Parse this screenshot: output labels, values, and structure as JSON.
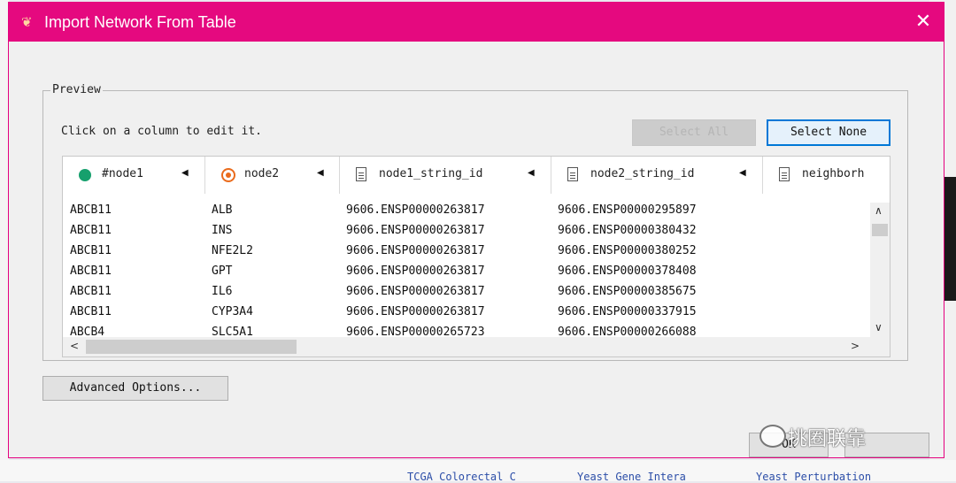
{
  "window": {
    "title": "Import Network From Table",
    "close_glyph": "✕",
    "app_icon": "cytoscape-icon"
  },
  "preview": {
    "legend": "Preview",
    "hint": "Click on a column to edit it.",
    "select_all_label": "Select All",
    "select_none_label": "Select None"
  },
  "table": {
    "columns": [
      {
        "label": "#node1",
        "icon": "source-node-icon"
      },
      {
        "label": "node2",
        "icon": "target-node-icon"
      },
      {
        "label": "node1_string_id",
        "icon": "attribute-icon"
      },
      {
        "label": "node2_string_id",
        "icon": "attribute-icon"
      },
      {
        "label": "neighborh",
        "icon": "attribute-icon"
      }
    ],
    "rows": [
      [
        "ABCB11",
        "ALB",
        "9606.ENSP00000263817",
        "9606.ENSP00000295897"
      ],
      [
        "ABCB11",
        "INS",
        "9606.ENSP00000263817",
        "9606.ENSP00000380432"
      ],
      [
        "ABCB11",
        "NFE2L2",
        "9606.ENSP00000263817",
        "9606.ENSP00000380252"
      ],
      [
        "ABCB11",
        "GPT",
        "9606.ENSP00000263817",
        "9606.ENSP00000378408"
      ],
      [
        "ABCB11",
        "IL6",
        "9606.ENSP00000263817",
        "9606.ENSP00000385675"
      ],
      [
        "ABCB11",
        "CYP3A4",
        "9606.ENSP00000263817",
        "9606.ENSP00000337915"
      ],
      [
        "ABCB4",
        "SLC5A1",
        "9606.ENSP00000265723",
        "9606.ENSP00000266088"
      ]
    ]
  },
  "footer": {
    "advanced_label": "Advanced Options...",
    "ok_label": "OK",
    "watermark": "挑圈联靠"
  },
  "background": {
    "links": [
      "TCGA Colorectal C",
      "Yeast Gene Intera",
      "Yeast Perturbation"
    ]
  },
  "colors": {
    "titlebar": "#e5097f",
    "source_icon": "#16a06d",
    "target_icon": "#ea6b1c"
  }
}
